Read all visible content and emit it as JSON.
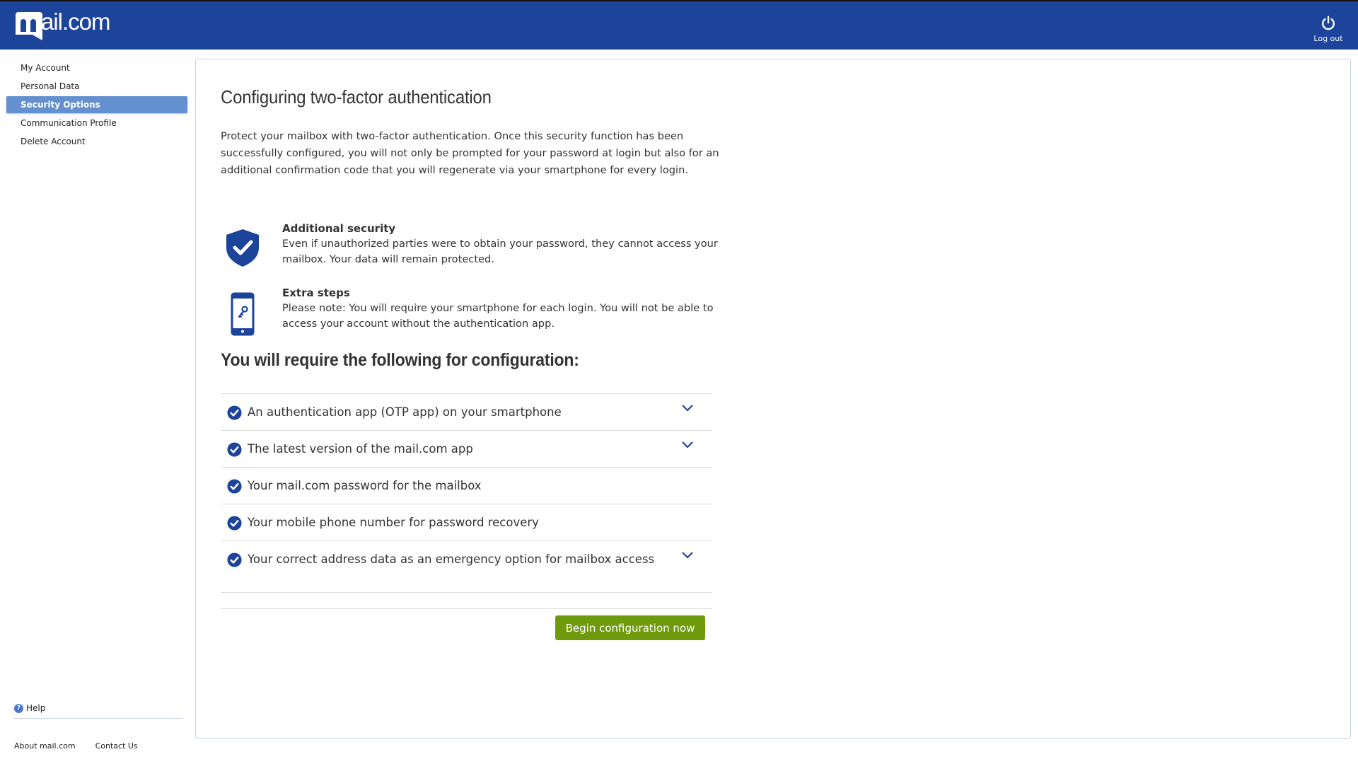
{
  "header": {
    "logo_text": "ail.com",
    "logout_label": "Log out",
    "brand_color": "#1c449b"
  },
  "sidebar": {
    "items": [
      {
        "label": "My Account",
        "active": false
      },
      {
        "label": "Personal Data",
        "active": false
      },
      {
        "label": "Security Options",
        "active": true
      },
      {
        "label": "Communication Profile",
        "active": false
      },
      {
        "label": "Delete Account",
        "active": false
      }
    ],
    "help_label": "Help",
    "footer_links": [
      "About mail.com",
      "Contact Us"
    ]
  },
  "main": {
    "title": "Configuring two-factor authentication",
    "intro": "Protect your mailbox with two-factor authentication. Once this security function has been successfully configured, you will not only be prompted for your password at login but also for an additional confirmation code that you will regenerate via your smartphone for every login.",
    "features": [
      {
        "icon": "shield-check-icon",
        "title": "Additional security",
        "text": "Even if unauthorized parties were to obtain your password, they cannot access your mailbox. Your data will remain protected."
      },
      {
        "icon": "smartphone-key-icon",
        "title": "Extra steps",
        "text": "Please note: You will require your smartphone for each login. You will not be able to access your account without the authentication app."
      }
    ],
    "requirements_heading": "You will require the following for configuration:",
    "requirements": [
      {
        "text": "An authentication app (OTP app) on your smartphone",
        "expandable": true
      },
      {
        "text": "The latest version of the mail.com app",
        "expandable": true
      },
      {
        "text": "Your mail.com password for the mailbox",
        "expandable": false
      },
      {
        "text": "Your mobile phone number for password recovery",
        "expandable": false
      },
      {
        "text": "Your correct address data as an emergency option for mailbox access",
        "expandable": true
      }
    ],
    "begin_button": "Begin configuration now",
    "button_color": "#6f9a0b"
  }
}
